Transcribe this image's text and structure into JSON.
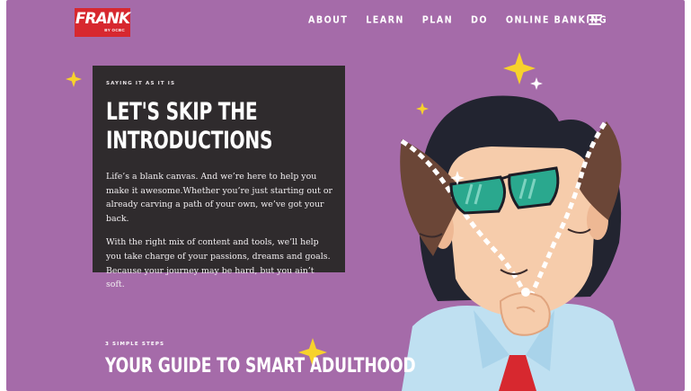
{
  "brand": {
    "wordmark": "FRANK",
    "byline": "BY OCBC",
    "color": "#d7282f"
  },
  "nav": {
    "items": [
      "ABOUT",
      "LEARN",
      "PLAN",
      "DO",
      "ONLINE BANKING"
    ],
    "menu_icon": "hamburger-menu-icon"
  },
  "hero": {
    "kicker": "SAYING IT AS IT IS",
    "title_line1": "LET'S SKIP THE",
    "title_line2": "INTRODUCTIONS",
    "paragraph1": "Life’s a blank canvas. And we’re here to help you make it awesome.Whether you’re just starting out or already carving a path of your own, we’ve got your back.",
    "paragraph2": "With the right mix of content and tools, we’ll help you take charge of your passions, dreams and goals. Because your journey may be hard, but you ain’t soft."
  },
  "steps": {
    "kicker": "3 SIMPLE STEPS",
    "title": "YOUR GUIDE TO SMART ADULTHOOD"
  },
  "theme": {
    "background": "#a56ba9",
    "card": "#2f2b2d",
    "sparkle": "#f7d22c"
  },
  "illustration": {
    "subject": "man-unzipping-face-illustration"
  }
}
